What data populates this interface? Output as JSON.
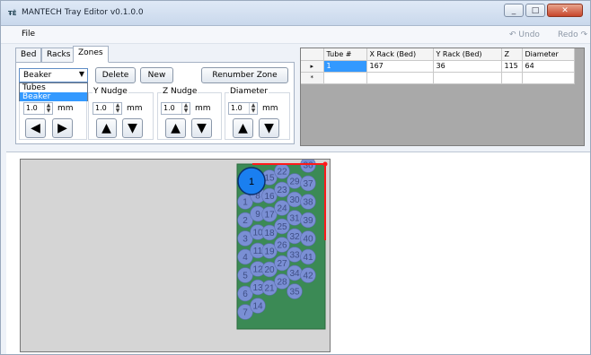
{
  "window": {
    "title": "MANTECH Tray Editor v0.1.0.0",
    "icon_text": "ŦĔ",
    "controls": [
      "minimize",
      "maximize",
      "close"
    ]
  },
  "menu": {
    "file": "File",
    "undo": "↶ Undo",
    "redo": "Redo ↷"
  },
  "tabs": [
    {
      "label": "Bed"
    },
    {
      "label": "Racks"
    },
    {
      "label": "Zones",
      "active": true
    }
  ],
  "zones_panel": {
    "zone_select": {
      "value": "Beaker",
      "options": [
        "Tubes",
        "Beaker"
      ],
      "highlighted": "Beaker"
    },
    "delete_label": "Delete",
    "new_label": "New",
    "renumber_label": "Renumber Zone",
    "x_group": {
      "value": "1.0",
      "unit": "mm"
    },
    "y_group": {
      "label": "Y Nudge",
      "value": "1.0",
      "unit": "mm"
    },
    "z_group": {
      "label": "Z Nudge",
      "value": "1.0",
      "unit": "mm"
    },
    "d_group": {
      "label": "Diameter",
      "value": "1.0",
      "unit": "mm"
    },
    "arrow_glyphs": {
      "left": "◀",
      "right": "▶",
      "up": "▲",
      "down": "▼"
    }
  },
  "grid": {
    "columns": [
      "Tube #",
      "X Rack (Bed)",
      "Y Rack (Bed)",
      "Z",
      "Diameter"
    ],
    "rows": [
      {
        "marker": "▸",
        "cells": [
          "1",
          "167",
          "36",
          "115",
          "64"
        ]
      }
    ],
    "new_row_marker": "*"
  },
  "rack": {
    "selected_label": "1",
    "tube_labels": [
      "1",
      "2",
      "3",
      "4",
      "5",
      "6",
      "7",
      "8",
      "9",
      "10",
      "11",
      "12",
      "13",
      "14",
      "15",
      "16",
      "17",
      "18",
      "19",
      "20",
      "21",
      "22",
      "23",
      "24",
      "25",
      "26",
      "27",
      "28",
      "29",
      "30",
      "31",
      "32",
      "33",
      "34",
      "35",
      "36",
      "37",
      "38",
      "39",
      "40",
      "41",
      "42"
    ],
    "colors": {
      "rack": "#3b8a55",
      "tube": "#7a8fd4",
      "selected_tube": "#1a7ff0",
      "marker": "#ff1a1a"
    }
  }
}
